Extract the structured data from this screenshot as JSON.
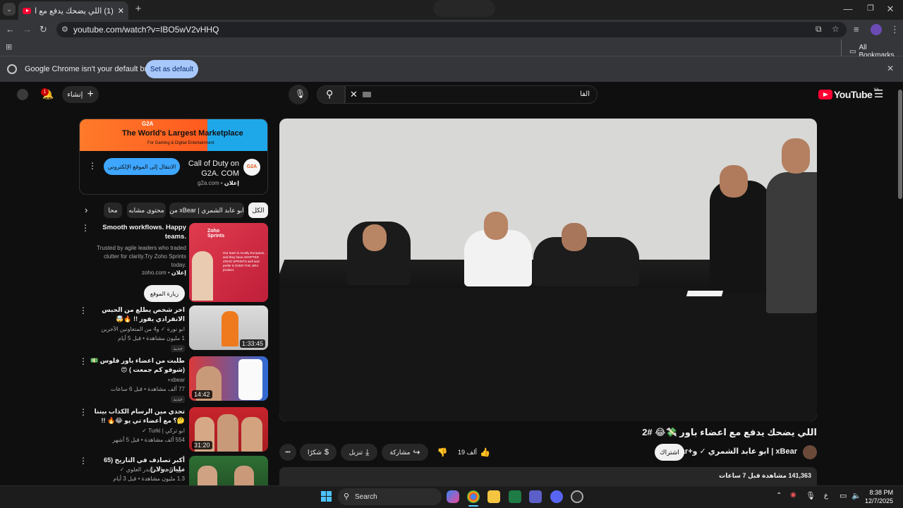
{
  "browser": {
    "tab_title": "(1) اللي يضحك يدفع مع اعضاء باور",
    "new_tab": "+",
    "url": "youtube.com/watch?v=IBO5wV2vHHQ",
    "bookmarks_label": "All Bookmarks",
    "infobar_text": "Google Chrome isn't your default browser",
    "set_default_label": "Set as default"
  },
  "youtube": {
    "logo_text": "YouTube",
    "logo_country": "SA",
    "search_value": "الفا",
    "create_label": "إنشاء",
    "notification_count": "1"
  },
  "ad": {
    "banner_brand": "G2A",
    "banner_title": "The World's Largest Marketplace",
    "banner_sub": "For Gaming & Digital Entertainment",
    "title_line1": "Call of Duty on",
    "title_line2": "G2A. COM",
    "sponsor": "g2a.com",
    "sponsor_tag": "إعلان",
    "cta": "الانتقال إلى الموقع الإلكتروني",
    "logo_text": "G2A"
  },
  "chips": [
    "الكل",
    "من xBear | ابو عابد الشمري",
    "محتوى مشابه",
    "محا"
  ],
  "sponsored_rec": {
    "title": "Smooth workflows. Happy teams.",
    "desc": "Trusted by agile leaders who traded clutter for clarity.Try Zoho Sprints today.",
    "source": "zoho.com",
    "source_tag": "إعلان",
    "cta": "زيارة الموقع",
    "thumb_logo": "Zoho Sprints",
    "thumb_quote": "Our team is mostly European, and they have ADOPTED ZOHO SPRINTS well and prefer it OVER THE JIRA product."
  },
  "recommendations": [
    {
      "title": "اخر شخص يطلع من الحبس الانفرادي يفوز !! 🔥🤯",
      "channel": "ابو نورة ✓ و4 من المتعاونين الآخرين",
      "meta": "1 مليون مشاهدة • قبل 5 أيام",
      "badge": "جديد",
      "duration": "1:33:45"
    },
    {
      "title": "طلبت من اعضاء باور فلوس 💵 (شوفو كم جمعت ) 😍",
      "channel": "xbear+",
      "meta": "77 ألف مشاهدة • قبل 6 ساعات",
      "badge": "جديد",
      "duration": "14:42"
    },
    {
      "title": "تحدي مين الرسام الكذاب بيننا 🤔؟ مع أعضاء تي يو 😂🔥 !!",
      "channel": "ابو تركي | Turki ✓",
      "meta": "554 ألف مشاهدة • قبل 5 أشهر",
      "badge": "",
      "duration": "31:20"
    },
    {
      "title": "أكبر تصادف في التاريخ (65 مليار دولار)",
      "channel": "قرية الجحاف | بدر العلوي ✓",
      "meta": "1.3 مليون مشاهدة • قبل 3 أيام",
      "badge": "",
      "duration": ""
    }
  ],
  "video": {
    "title": "اللي يضحك يدفع مع اعضاء باور 💸😂 #2",
    "channel": "xBear | ابو عابد الشمري ✓ و+xbear",
    "subscribe": "اشتراك",
    "likes": "19 ألف",
    "share": "مشاركة",
    "download": "تنزيل",
    "thanks": "شكرًا",
    "more": "•••",
    "views": "141,363 مشاهدة قبل 7 ساعات"
  },
  "taskbar": {
    "search_placeholder": "Search",
    "time": "8:38 PM",
    "date": "12/7/2025",
    "lang": "ع"
  }
}
